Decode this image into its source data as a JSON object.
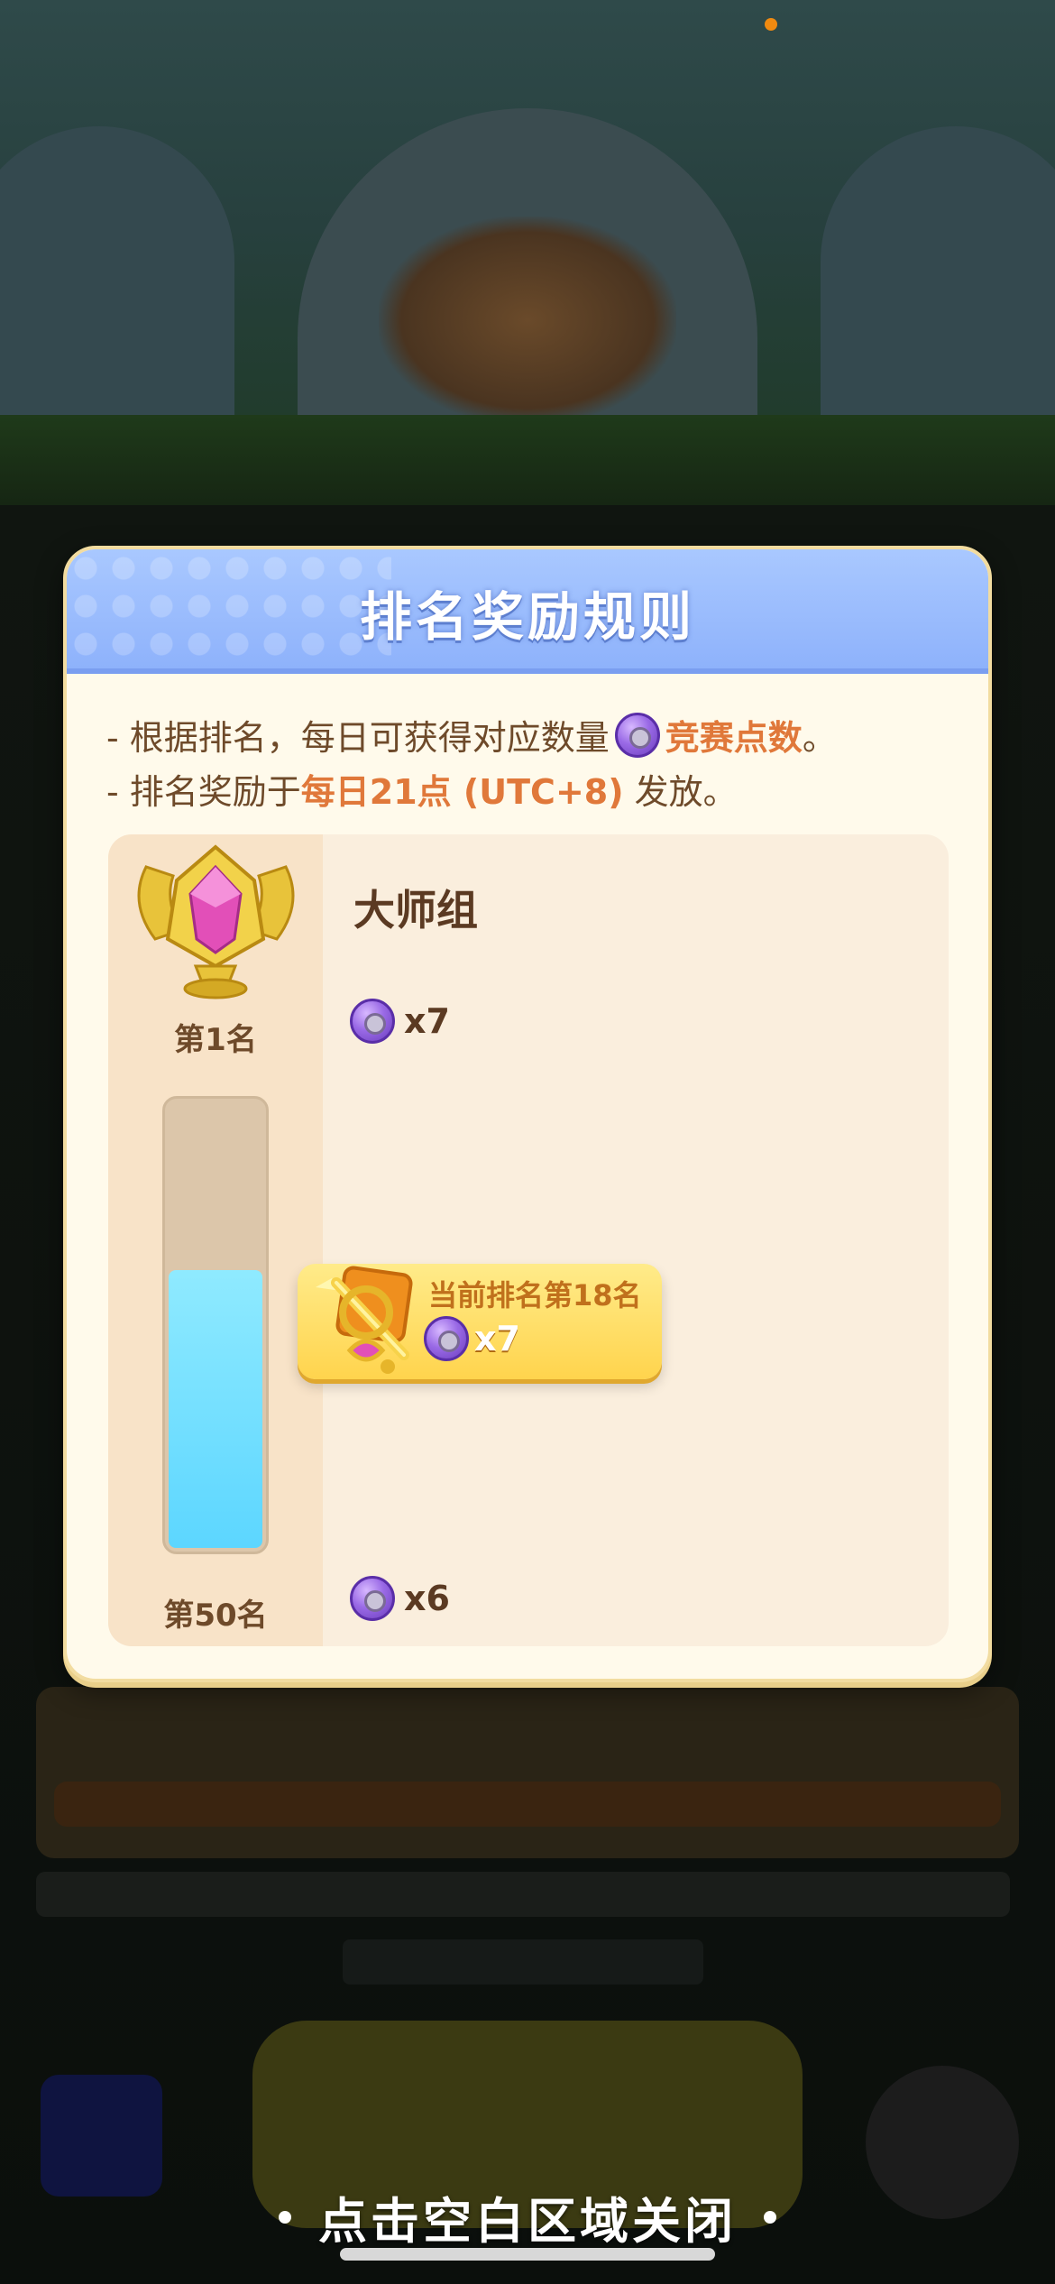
{
  "modal": {
    "title": "排名奖励规则",
    "rule1_prefix": "- 根据排名，每日可获得对应数量",
    "rule1_highlight": "竞赛点数",
    "rule1_suffix": "。",
    "rule2_prefix": "- 排名奖励于",
    "rule2_highlight": "每日21点 (UTC+8)",
    "rule2_suffix": " 发放。",
    "group_name": "大师组",
    "top_rank_label": "第1名",
    "bottom_rank_label": "第50名",
    "top_reward": "x7",
    "bottom_reward": "x6",
    "current_rank_text": "当前排名第18名",
    "current_reward": "x7",
    "progress": 0.63
  },
  "close_hint": "点击空白区域关闭",
  "icons": {
    "points": "competition-points-coin-icon",
    "trophy": "master-trophy-icon",
    "avatar": "golden-sword-avatar-icon"
  },
  "colors": {
    "header": "#8eb2fb",
    "highlight": "#e0783a",
    "progress_fill": "#5cd6ff",
    "tag": "#ffd44d"
  }
}
